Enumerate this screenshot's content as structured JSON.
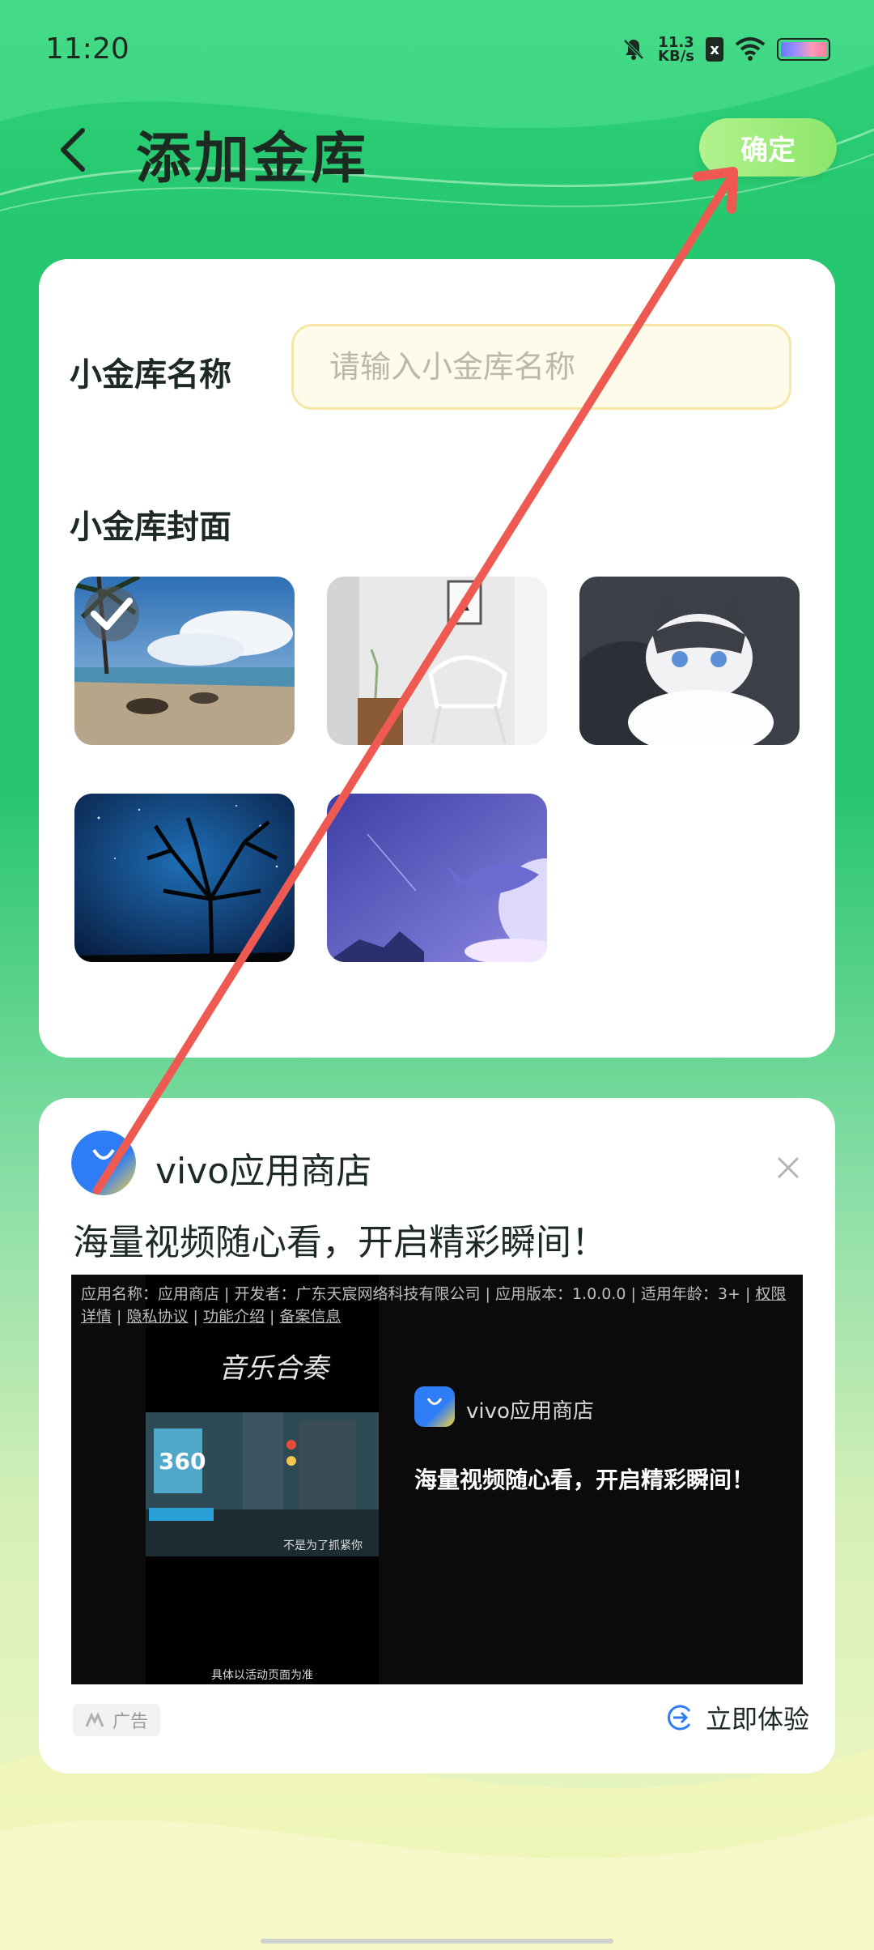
{
  "status_bar": {
    "time": "11:20",
    "speed_value": "11.3",
    "speed_unit": "KB/s",
    "sim_label": "x"
  },
  "header": {
    "title": "添加金库",
    "confirm_label": "确定"
  },
  "form": {
    "name_label": "小金库名称",
    "name_placeholder": "请输入小金库名称",
    "cover_label": "小金库封面",
    "covers": [
      "beach",
      "chair-room",
      "cat",
      "night-tree",
      "whale"
    ],
    "selected_cover_index": 0
  },
  "ad": {
    "app_name": "vivo应用商店",
    "headline": "海量视频随心看，开启精彩瞬间！",
    "info_text": "应用名称：应用商店 | 开发者：广东天宸网络科技有限公司 | 应用版本：1.0.0.0 | 适用年龄：3+ |",
    "info_links": [
      "权限详情",
      "隐私协议",
      "功能介绍",
      "备案信息"
    ],
    "video_signature": "音乐合奏",
    "video_subtitle": "不是为了抓紧你",
    "video_footer": "具体以活动页面为准",
    "video_badge": "360",
    "media_app_name": "vivo应用商店",
    "media_headline": "海量视频随心看，开启精彩瞬间！",
    "badge_label": "广告",
    "cta_label": "立即体验"
  },
  "colors": {
    "accent_green": "#26c470",
    "confirm_bg": "#a6ee80",
    "input_border": "#f6e7a6",
    "annotation_arrow": "#ee5a52"
  }
}
